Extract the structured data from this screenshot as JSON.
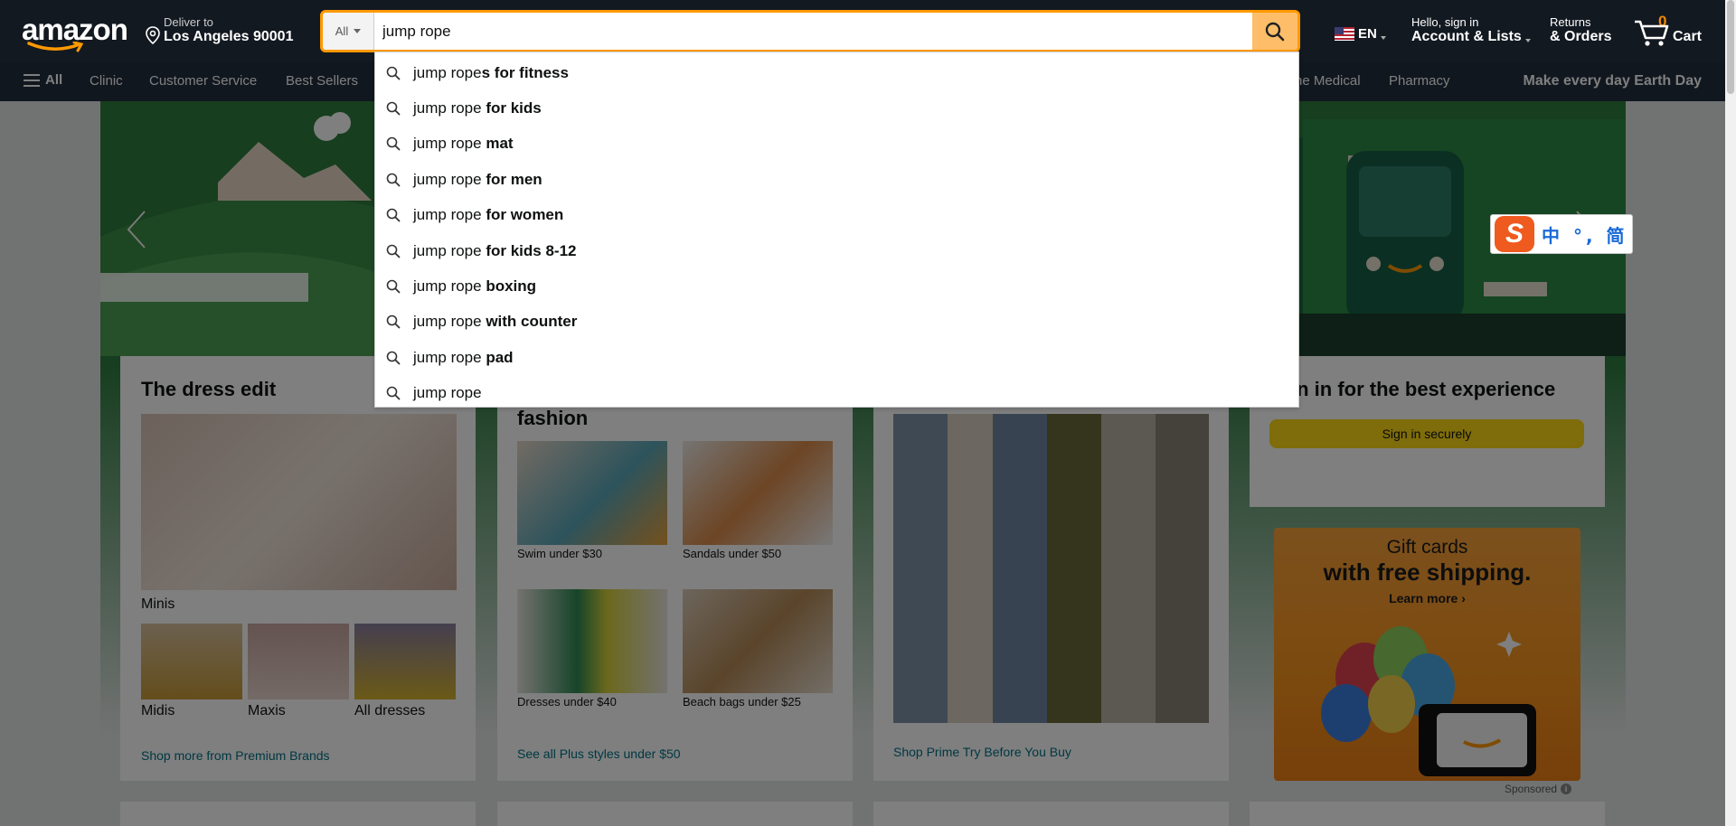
{
  "header": {
    "logo_text": "amazon",
    "deliver_line1": "Deliver to",
    "deliver_line2": "Los Angeles 90001",
    "search_category": "All",
    "search_value": "jump rope",
    "lang": "EN",
    "account_line1": "Hello, sign in",
    "account_line2": "Account & Lists",
    "orders_line1": "Returns",
    "orders_line2": "& Orders",
    "cart_count": "0",
    "cart_label": "Cart"
  },
  "nav": {
    "all_label": "All",
    "items": [
      "Clinic",
      "Customer Service",
      "Best Sellers"
    ],
    "right_items": [
      "ne Medical",
      "Pharmacy"
    ],
    "promo": "Make every day Earth Day"
  },
  "suggestions": [
    {
      "prefix": "jump rope",
      "suffix": "s for fitness"
    },
    {
      "prefix": "jump rope ",
      "suffix": "for kids"
    },
    {
      "prefix": "jump rope ",
      "suffix": "mat"
    },
    {
      "prefix": "jump rope ",
      "suffix": "for men"
    },
    {
      "prefix": "jump rope ",
      "suffix": "for women"
    },
    {
      "prefix": "jump rope ",
      "suffix": "for kids 8-12"
    },
    {
      "prefix": "jump rope ",
      "suffix": "boxing"
    },
    {
      "prefix": "jump rope ",
      "suffix": "with counter"
    },
    {
      "prefix": "jump rope ",
      "suffix": "pad"
    },
    {
      "prefix": "jump rope",
      "suffix": ""
    }
  ],
  "cards": {
    "dress": {
      "title": "The dress edit",
      "main_caption": "Minis",
      "captions": [
        "Midis",
        "Maxis",
        "All dresses"
      ],
      "link": "Shop more from Premium Brands"
    },
    "plus": {
      "title_tail": "fashion",
      "captions": [
        "Swim under $30",
        "Sandals under $50",
        "Dresses under $40",
        "Beach bags under $25"
      ],
      "link": "See all Plus styles under $50"
    },
    "prime": {
      "link": "Shop Prime Try Before You Buy"
    },
    "signin": {
      "title": "in in for the best experience",
      "button": "Sign in securely"
    }
  },
  "giftcard": {
    "line1": "Gift cards",
    "line2": "with free shipping.",
    "line3": "Learn more ›",
    "sponsored": "Sponsored"
  },
  "ime": {
    "logo": "S",
    "text": "中 °, 简"
  },
  "colors": {
    "nav_dark": "#131921",
    "nav_secondary": "#232f3e",
    "search_accent": "#febd69",
    "link": "#007185",
    "button_yellow": "#ffd814",
    "hero_green": "#2a7a3c"
  }
}
